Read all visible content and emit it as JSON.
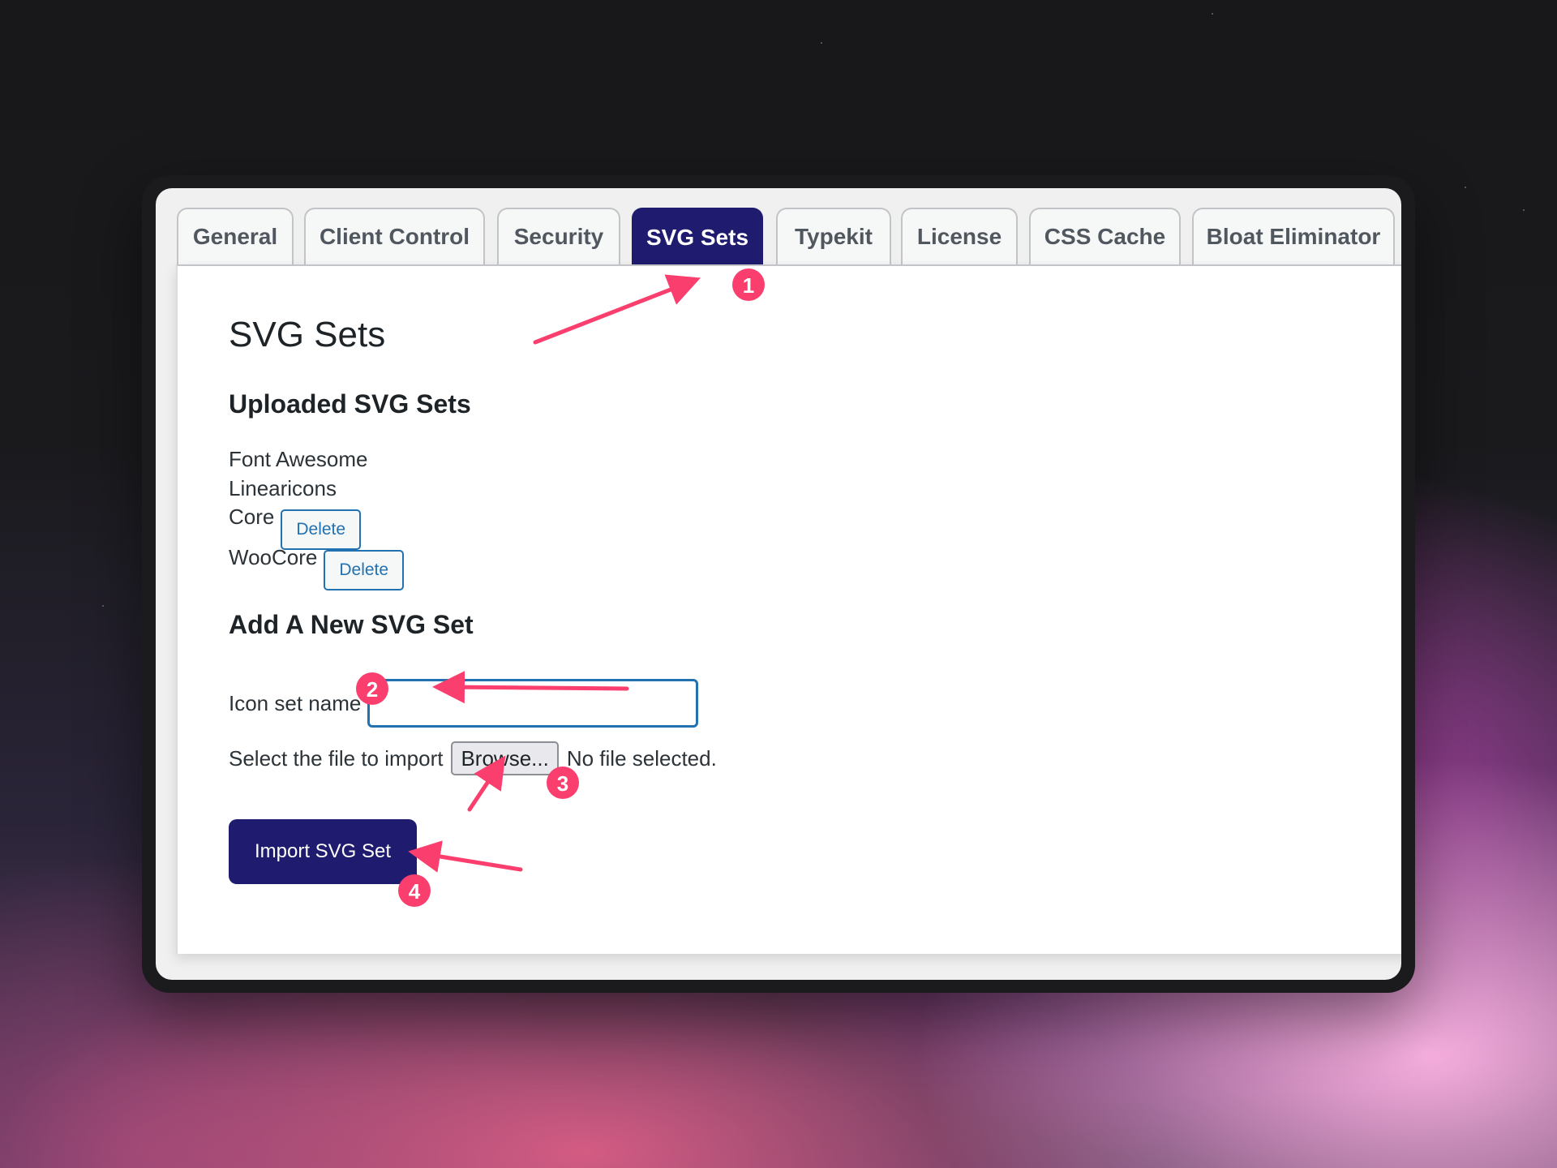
{
  "tabs": [
    {
      "label": "General",
      "active": false
    },
    {
      "label": "Client Control",
      "active": false
    },
    {
      "label": "Security",
      "active": false
    },
    {
      "label": "SVG Sets",
      "active": true
    },
    {
      "label": "Typekit",
      "active": false
    },
    {
      "label": "License",
      "active": false
    },
    {
      "label": "CSS Cache",
      "active": false
    },
    {
      "label": "Bloat Eliminator",
      "active": false
    }
  ],
  "page": {
    "title": "SVG Sets",
    "uploaded_title": "Uploaded SVG Sets",
    "uploaded_sets": [
      {
        "name": "Font Awesome",
        "delete_label": ""
      },
      {
        "name": "Linearicons",
        "delete_label": ""
      },
      {
        "name": "Core",
        "delete_label": "Delete"
      },
      {
        "name": "WooCore",
        "delete_label": "Delete"
      }
    ],
    "add_title": "Add A New SVG Set",
    "icon_name_label": "Icon set name",
    "icon_name_value": "",
    "file_label": "Select the file to import",
    "browse_label": "Browse...",
    "file_status": "No file selected.",
    "import_label": "Import SVG Set"
  },
  "annotations": {
    "markers": [
      "1",
      "2",
      "3",
      "4"
    ]
  },
  "colors": {
    "accent": "#1f1b6e",
    "link": "#2271b1",
    "annotation": "#fa3f6e"
  }
}
